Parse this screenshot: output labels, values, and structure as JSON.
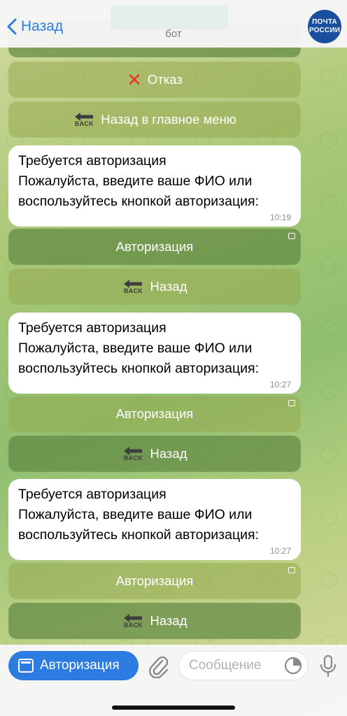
{
  "header": {
    "back_label": "Назад",
    "subtitle": "бот",
    "avatar_line1": "ПОЧТА",
    "avatar_line2": "РОССИИ"
  },
  "messages": [
    {
      "type": "button",
      "label": "Отказ",
      "icon": "x-icon"
    },
    {
      "type": "button",
      "label": "Назад в главное меню",
      "icon": "back-icon"
    },
    {
      "type": "bubble",
      "line1": "Требуется авторизация",
      "line2": "Пожалуйста, введите ваше ФИО или",
      "line3": "воспользуйтесь кнопкой авторизация:",
      "time": "10:19"
    },
    {
      "type": "button",
      "label": "Авторизация",
      "icon": "webapp-icon"
    },
    {
      "type": "button",
      "label": "Назад",
      "icon": "back-icon"
    },
    {
      "type": "bubble",
      "line1": "Требуется авторизация",
      "line2": "Пожалуйста, введите ваше ФИО или",
      "line3": "воспользуйтесь кнопкой авторизация:",
      "time": "10:27"
    },
    {
      "type": "button",
      "label": "Авторизация",
      "icon": "webapp-icon"
    },
    {
      "type": "button",
      "label": "Назад",
      "icon": "back-icon"
    },
    {
      "type": "bubble",
      "line1": "Требуется авторизация",
      "line2": "Пожалуйста, введите ваше ФИО или",
      "line3": "воспользуйтесь кнопкой авторизация:",
      "time": "10:27"
    },
    {
      "type": "button",
      "label": "Авторизация",
      "icon": "webapp-icon"
    },
    {
      "type": "button",
      "label": "Назад",
      "icon": "back-icon"
    }
  ],
  "back_icon_text": "BACK",
  "composer": {
    "auth_button_label": "Авторизация",
    "placeholder": "Сообщение"
  },
  "colors": {
    "accent": "#2c7be0",
    "reject_icon": "#e8342b"
  }
}
